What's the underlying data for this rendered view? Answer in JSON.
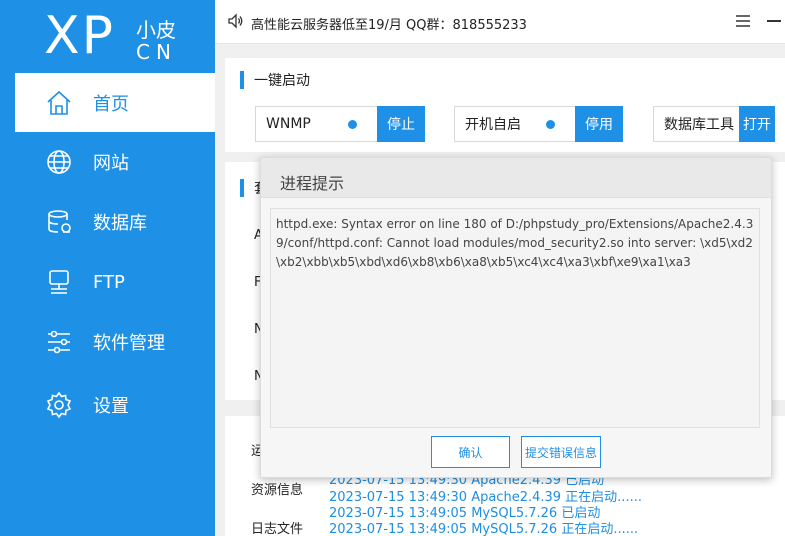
{
  "logo": {
    "primary": "XP",
    "secondary_top": "小皮",
    "secondary_bottom": "CN"
  },
  "sidebar": {
    "items": [
      {
        "label": "首页",
        "icon": "home-icon",
        "active": true
      },
      {
        "label": "网站",
        "icon": "globe-icon",
        "active": false
      },
      {
        "label": "数据库",
        "icon": "database-icon",
        "active": false
      },
      {
        "label": "FTP",
        "icon": "server-icon",
        "active": false
      },
      {
        "label": "软件管理",
        "icon": "sliders-icon",
        "active": false
      },
      {
        "label": "设置",
        "icon": "gear-icon",
        "active": false
      }
    ]
  },
  "topbar": {
    "notice": "高性能云服务器低至19/月  QQ群：818555233"
  },
  "quickstart": {
    "title": "一键启动",
    "services": [
      {
        "name": "WNMP",
        "action": "停止",
        "status_color": "#1e90e6"
      },
      {
        "name": "开机自启",
        "action": "停用",
        "status_color": "#1e90e6"
      },
      {
        "name": "数据库工具",
        "action": "打开"
      }
    ]
  },
  "section2": {
    "title_partial": "套",
    "letters": [
      "A",
      "F",
      "N",
      "N"
    ]
  },
  "logs": {
    "tab_partial": "运",
    "labels": [
      "资源信息",
      "日志文件"
    ],
    "lines": [
      "2023-07-15 13:49:30 Apache2.4.39 已启动",
      "2023-07-15 13:49:30 Apache2.4.39 正在启动......",
      "2023-07-15 13:49:05 MySQL5.7.26 已启动",
      "2023-07-15 13:49:05 MySQL5.7.26 正在启动......"
    ]
  },
  "dialog": {
    "title": "进程提示",
    "message": "httpd.exe: Syntax error on line 180 of D:/phpstudy_pro/Extensions/Apache2.4.39/conf/httpd.conf: Cannot load modules/mod_security2.so into server: \\xd5\\xd2\\xb2\\xbb\\xb5\\xbd\\xd6\\xb8\\xb6\\xa8\\xb5\\xc4\\xc4\\xa3\\xbf\\xe9\\xa1\\xa3",
    "confirm_label": "确认",
    "report_label": "提交错误信息"
  },
  "colors": {
    "accent": "#1e90e6",
    "log_text": "#1e8ee0"
  }
}
